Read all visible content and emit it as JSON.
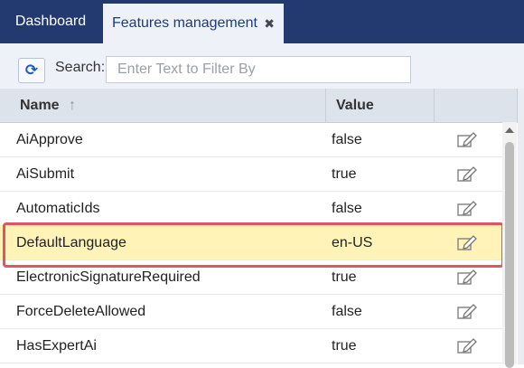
{
  "tabs": {
    "dashboard": "Dashboard",
    "features": "Features management",
    "close_glyph": "✖"
  },
  "toolbar": {
    "refresh_icon": "refresh-icon",
    "search_label": "Search:",
    "search_placeholder": "Enter Text to Filter By",
    "search_value": ""
  },
  "grid": {
    "columns": [
      "Name",
      "Value"
    ],
    "sort_glyph": "↑",
    "rows": [
      {
        "name": "AiApprove",
        "value": "false"
      },
      {
        "name": "AiSubmit",
        "value": "true"
      },
      {
        "name": "AutomaticIds",
        "value": "false"
      },
      {
        "name": "DefaultLanguage",
        "value": "en-US"
      },
      {
        "name": "ElectronicSignatureRequired",
        "value": "true"
      },
      {
        "name": "ForceDeleteAllowed",
        "value": "false"
      },
      {
        "name": "HasExpertAi",
        "value": "true"
      }
    ],
    "selected_row": "DefaultLanguage"
  },
  "colors": {
    "tabbar": "#223a70",
    "selected_row": "#fff3b8",
    "highlight": "#e0565c"
  }
}
